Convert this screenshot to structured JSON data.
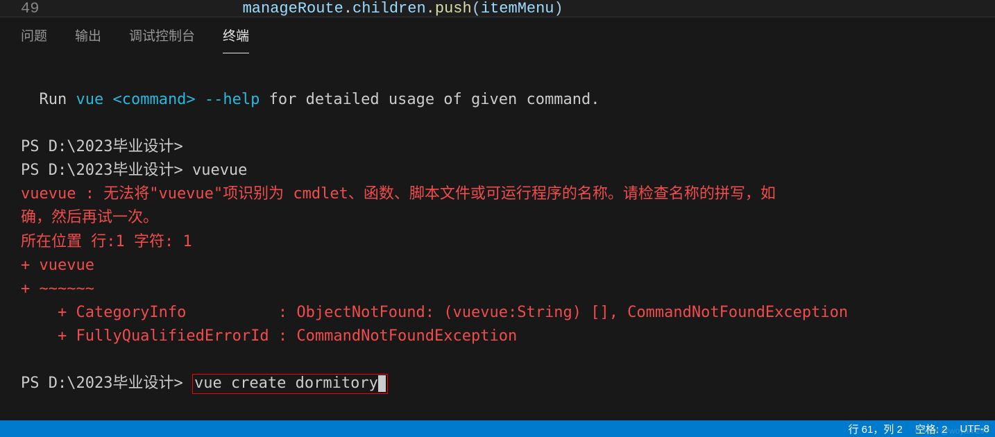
{
  "editor": {
    "line_num": "49",
    "code": {
      "obj": "manageRoute",
      "prop": "children",
      "method": "push",
      "param": "itemMenu"
    }
  },
  "tabs": {
    "problems": "问题",
    "output": "输出",
    "debug_console": "调试控制台",
    "terminal": "终端"
  },
  "terminal": {
    "help_prefix": "  Run ",
    "help_cmd1": "vue ",
    "help_cmd2": "<command> ",
    "help_cmd3": "--help",
    "help_suffix": " for detailed usage of given command.",
    "prompt1": "PS D:\\2023毕业设计>",
    "prompt2": "PS D:\\2023毕业设计> ",
    "prompt2_cmd": "vuevue",
    "error_line1": "vuevue : 无法将\"vuevue\"项识别为 cmdlet、函数、脚本文件或可运行程序的名称。请检查名称的拼写，如",
    "error_line2": "确，然后再试一次。",
    "error_line3": "所在位置 行:1 字符: 1",
    "error_line4": "+ vuevue",
    "error_line5": "+ ~~~~~~",
    "error_line6": "    + CategoryInfo          : ObjectNotFound: (vuevue:String) [], CommandNotFoundException",
    "error_line7": "    + FullyQualifiedErrorId : CommandNotFoundException",
    "prompt3": "PS D:\\2023毕业设计> ",
    "prompt3_cmd": "vue create dormitory"
  },
  "status": {
    "line_col": "行 61，列 2",
    "spaces": "空格: 2",
    "encoding": "UTF-8"
  },
  "watermark": "CSDN @woyan 297"
}
